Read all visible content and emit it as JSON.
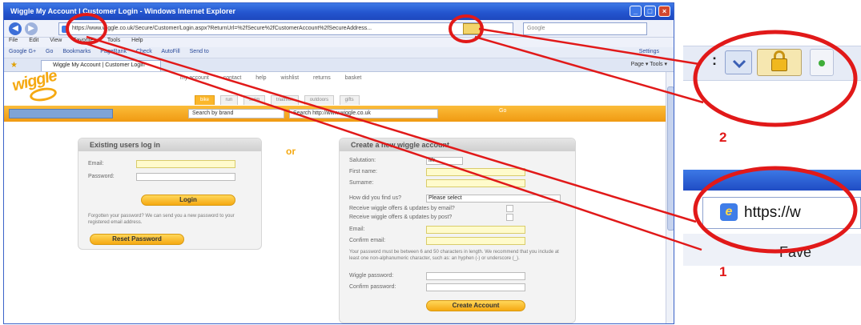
{
  "browser": {
    "title": "Wiggle My Account | Customer Login - Windows Internet Explorer",
    "url": "https://www.wiggle.co.uk/Secure/Customer/Login.aspx?ReturnUrl=%2fSecure%2fCustomerAccount%2fSecureAddress...",
    "search_placeholder": "Google",
    "menu": [
      "File",
      "Edit",
      "View",
      "Favorites",
      "Tools",
      "Help"
    ],
    "google_toolbar": [
      "Google G+",
      "Go",
      "Bookmarks",
      "PageRank",
      "Check",
      "AutoFill",
      "Send to",
      "Settings"
    ],
    "tab_title": "Wiggle My Account | Customer Login",
    "tab_tools": "Page ▾   Tools ▾"
  },
  "site": {
    "logo": "wiggle",
    "top_links": [
      "my account",
      "contact",
      "help",
      "wishlist",
      "returns",
      "basket"
    ],
    "nav_tabs": [
      "bike",
      "run",
      "swim",
      "triathlon",
      "outdoors",
      "gifts"
    ],
    "search_brand": "Search by brand",
    "search_site": "Search http://www.wiggle.co.uk",
    "go": "Go"
  },
  "login": {
    "heading": "Existing users log in",
    "email_label": "Email:",
    "password_label": "Password:",
    "login_button": "Login",
    "forgotten_text": "Forgotten your password? We can send you a new password to your registered email address.",
    "reset_button": "Reset Password"
  },
  "or_text": "or",
  "register": {
    "heading": "Create a new wiggle account",
    "salutation_label": "Salutation:",
    "salutation_value": "Mr",
    "firstname_label": "First name:",
    "surname_label": "Surname:",
    "heard_label": "How did you find us?",
    "heard_value": "Please select",
    "offers_email_label": "Receive wiggle offers & updates by email?",
    "offers_post_label": "Receive wiggle offers & updates by post?",
    "email_label": "Email:",
    "confirm_email_label": "Confirm email:",
    "password_note": "Your password must be between 6 and 50 characters in length. We recommend that you include at least one non-alphanumeric character, such as: an hyphen (-) or underscore (_).",
    "password_label": "Wiggle password:",
    "confirm_password_label": "Confirm password:",
    "create_button": "Create Account"
  },
  "zoom_insets": {
    "address_text": "https://w",
    "favorites_cut": "Fave",
    "inset_number_1": "1",
    "inset_number_2": "2"
  },
  "colors": {
    "accent_orange": "#f5a912",
    "annotation_red": "#e11919",
    "ie_blue": "#2455cf"
  }
}
